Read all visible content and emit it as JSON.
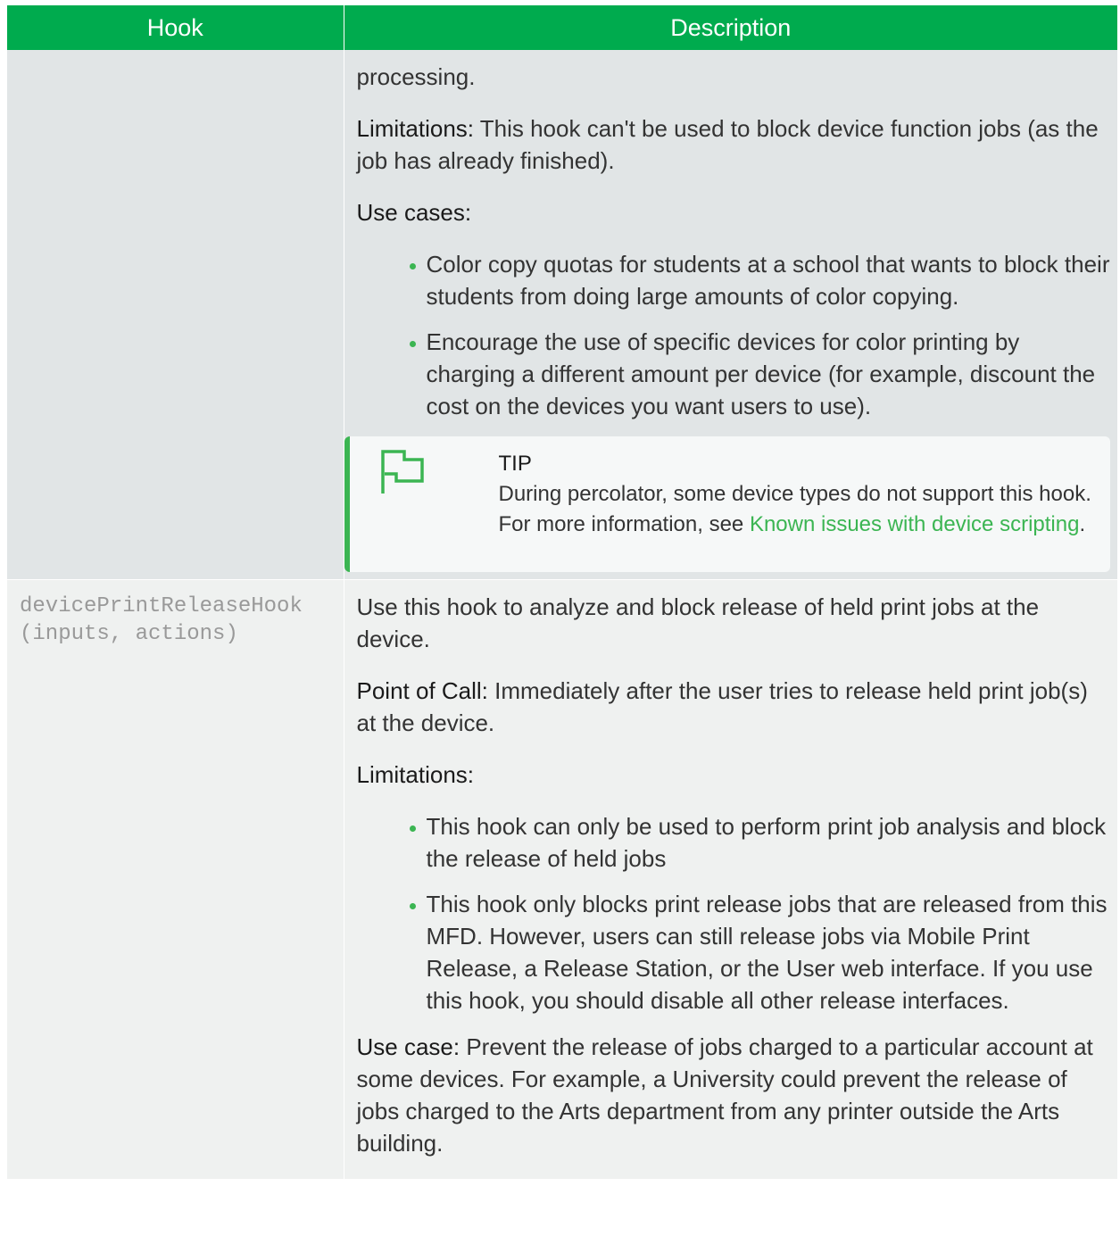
{
  "table": {
    "headers": {
      "hook": "Hook",
      "description": "Description"
    },
    "row1": {
      "para1": "processing.",
      "limitations_label": "Limitations:",
      "limitations_text": " This hook can't be used to block device function jobs (as the job has already finished).",
      "usecases_label": "Use cases:",
      "usecases": [
        "Color copy quotas for students at a school that wants to block their students from doing large amounts of color copying.",
        "Encourage the use of specific devices for color printing by charging a different amount per device (for example, discount the cost on the devices you want users to use)."
      ],
      "tip": {
        "icon": "flag-icon",
        "title": "TIP",
        "text": "During percolator, some device types do not support this hook. For more information, see ",
        "link": "Known issues with device scripting",
        "after": "."
      }
    },
    "row2": {
      "hook_line1": "devicePrintReleaseHook",
      "hook_line2": "(inputs, actions)",
      "intro": "Use this hook to analyze and block release of held print jobs at the device.",
      "poc_label": "Point of Call:",
      "poc_text": " Immediately after the user tries to release held print job(s) at the device.",
      "limitations_label": "Limitations:",
      "limitations": [
        "This hook can only be used to perform print job analysis and block the release of held jobs",
        "This hook only blocks print release jobs that are released from this MFD. However, users can still release jobs via Mobile Print Release, a Release Station, or the User web interface. If you use this hook, you should disable all other release interfaces."
      ],
      "usecase_label": "Use case:",
      "usecase_text": " Prevent the release of jobs charged to a particular account at some devices. For example, a University could prevent the release of jobs charged to the Arts department from any printer outside the Arts building."
    }
  },
  "colors": {
    "header_bg": "#00ab4e",
    "accent": "#3bb552"
  }
}
